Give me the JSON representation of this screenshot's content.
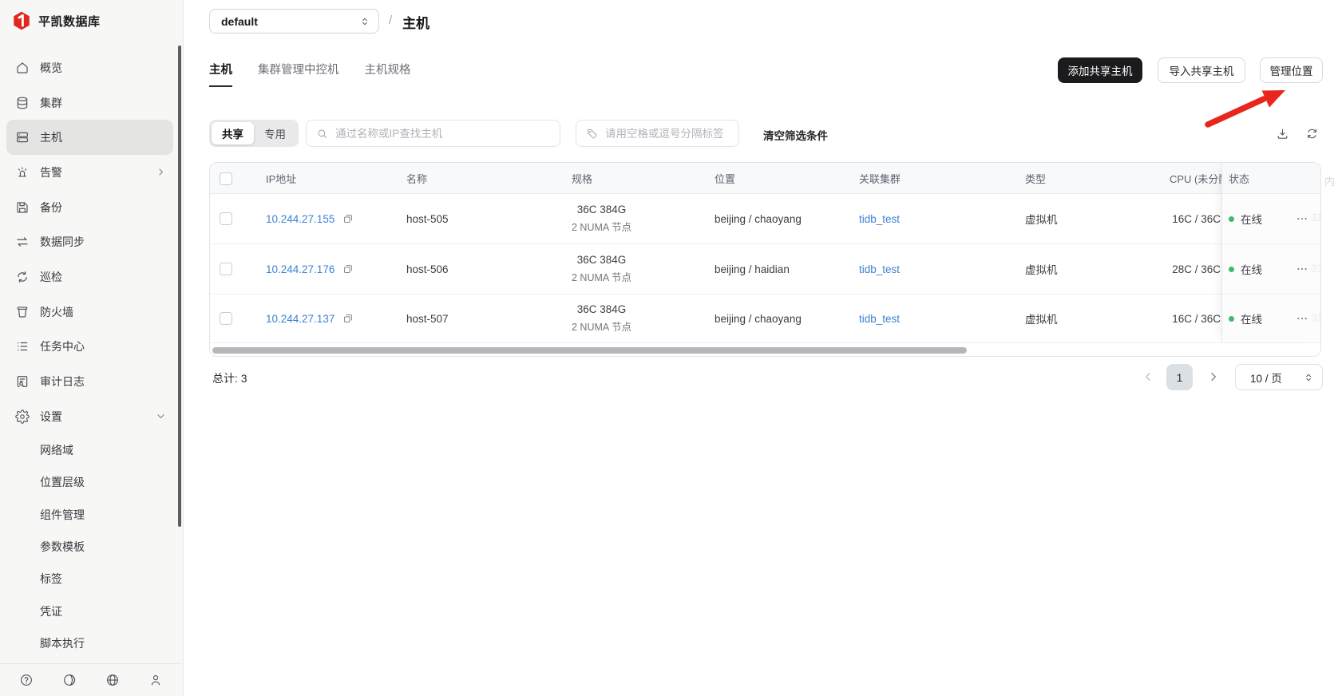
{
  "colors": {
    "accent_red": "#e0281e",
    "link_blue": "#3b82d6",
    "status_green": "#3dba6e",
    "primary_button_bg": "#1b1b1d"
  },
  "brand": {
    "name": "平凯数据库"
  },
  "sidebar": {
    "items": [
      {
        "label": "概览"
      },
      {
        "label": "集群"
      },
      {
        "label": "主机",
        "selected": true
      },
      {
        "label": "告警",
        "has_submenu": true
      },
      {
        "label": "备份"
      },
      {
        "label": "数据同步"
      },
      {
        "label": "巡检"
      },
      {
        "label": "防火墙"
      },
      {
        "label": "任务中心"
      },
      {
        "label": "审计日志"
      },
      {
        "label": "设置",
        "expanded": true
      }
    ],
    "settings_children": [
      {
        "label": "网络域"
      },
      {
        "label": "位置层级"
      },
      {
        "label": "组件管理"
      },
      {
        "label": "参数模板"
      },
      {
        "label": "标签"
      },
      {
        "label": "凭证"
      },
      {
        "label": "脚本执行"
      }
    ]
  },
  "breadcrumb": {
    "scope": "default",
    "separator": "/",
    "page": "主机"
  },
  "tabs": [
    {
      "label": "主机",
      "active": true
    },
    {
      "label": "集群管理中控机"
    },
    {
      "label": "主机规格"
    }
  ],
  "actions": {
    "add_shared_host": "添加共享主机",
    "import_shared_host": "导入共享主机",
    "manage_location": "管理位置"
  },
  "filters": {
    "share_toggle": {
      "options": [
        "共享",
        "专用"
      ],
      "active": "共享"
    },
    "search_placeholder": "通过名称或IP查找主机",
    "tag_placeholder": "请用空格或逗号分隔标签",
    "clear_label": "清空筛选条件"
  },
  "table": {
    "headers": {
      "ip": "IP地址",
      "name": "名称",
      "spec": "规格",
      "location": "位置",
      "cluster": "关联集群",
      "type": "类型",
      "cpu": "CPU (未分配量)",
      "status": "状态"
    },
    "peek": {
      "header_fragment": "内",
      "row_fragments": [
        "31",
        "33",
        "31"
      ]
    },
    "rows": [
      {
        "ip": "10.244.27.155",
        "name": "host-505",
        "spec_line1": "36C 384G",
        "spec_line2": "2 NUMA 节点",
        "location": "beijing / chaoyang",
        "cluster": "tidb_test",
        "type": "虚拟机",
        "cpu": "16C / 36C",
        "status": "在线"
      },
      {
        "ip": "10.244.27.176",
        "name": "host-506",
        "spec_line1": "36C 384G",
        "spec_line2": "2 NUMA 节点",
        "location": "beijing / haidian",
        "cluster": "tidb_test",
        "type": "虚拟机",
        "cpu": "28C / 36C",
        "status": "在线"
      },
      {
        "ip": "10.244.27.137",
        "name": "host-507",
        "spec_line1": "36C 384G",
        "spec_line2": "2 NUMA 节点",
        "location": "beijing / chaoyang",
        "cluster": "tidb_test",
        "type": "虚拟机",
        "cpu": "16C / 36C",
        "status": "在线"
      }
    ]
  },
  "footer": {
    "total": "总计: 3",
    "current_page": "1",
    "page_size": "10 / 页"
  }
}
